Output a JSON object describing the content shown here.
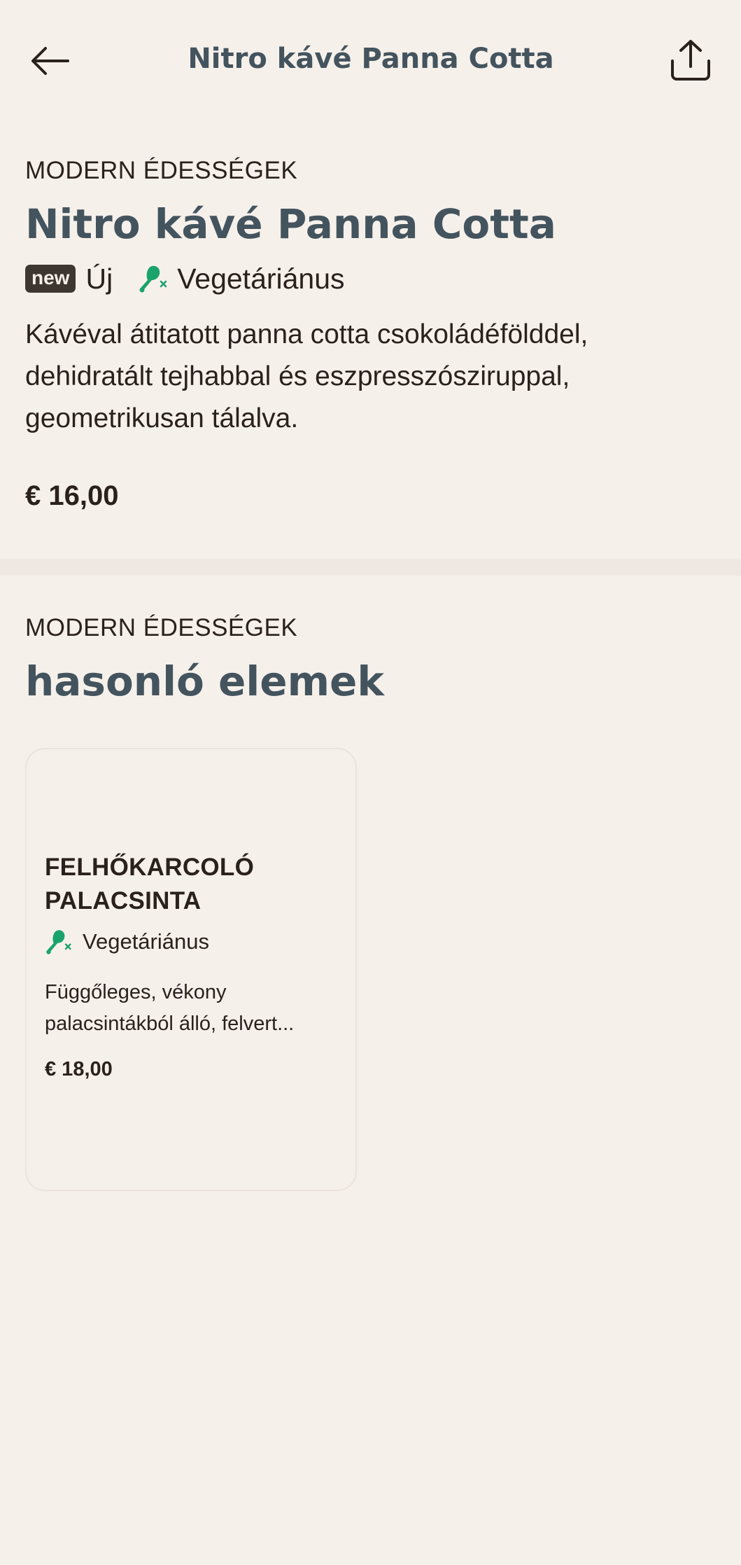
{
  "header": {
    "title": "Nitro kávé Panna Cotta",
    "back_icon": "arrow-left-icon",
    "share_icon": "share-icon"
  },
  "item": {
    "category": "MODERN ÉDESSÉGEK",
    "title": "Nitro kávé Panna Cotta",
    "badge": "new",
    "new_label": "Új",
    "veg_label": "Vegetáriánus",
    "description": "Kávéval átitatott panna cotta csokoládéfölddel, dehidratált tejhabbal és eszpresszósziruppal, geometrikusan tálalva.",
    "price": "€ 16,00"
  },
  "similar": {
    "category": "MODERN ÉDESSÉGEK",
    "title": "hasonló elemek",
    "items": [
      {
        "title": "FELHŐKARCOLÓ PALACSINTA",
        "veg_label": "Vegetáriánus",
        "description": "Függőleges, vékony palacsintákból álló, felvert...",
        "price": "€ 18,00"
      }
    ]
  },
  "colors": {
    "background": "#f6f0eb",
    "title": "#44545e",
    "text": "#2a211d",
    "veg_green": "#1aa36a",
    "badge_bg": "#3d3631"
  }
}
